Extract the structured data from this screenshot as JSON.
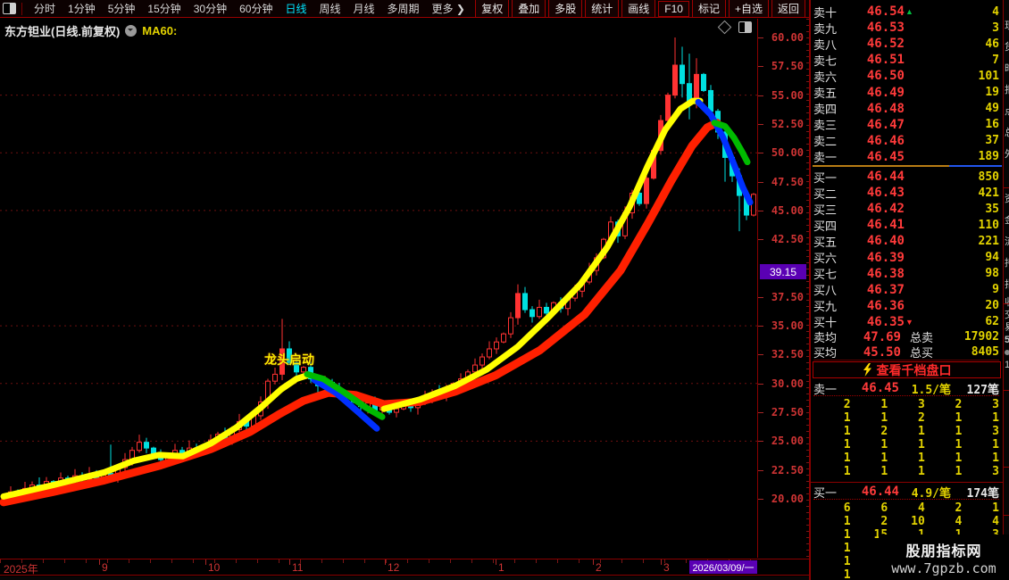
{
  "colors": {
    "up": "#ff3232",
    "down": "#00e0e0",
    "ma_yellow": "#ffff00",
    "ma_red": "#ff2000",
    "ma_green": "#00bb00",
    "ma_blue": "#0030ff",
    "axis_red": "#cf3434",
    "grid_red": "#6e1010",
    "marker_purple": "#5a00b4",
    "active_cyan": "#00e5ff",
    "vol_yellow": "#e3d300",
    "price_red": "#ff3a3a"
  },
  "toolbar": {
    "periods": [
      "分时",
      "1分钟",
      "5分钟",
      "15分钟",
      "30分钟",
      "60分钟",
      "日线",
      "周线",
      "月线",
      "多周期",
      "更多 ❯"
    ],
    "active_index": 6,
    "right_buttons": [
      "复权",
      "叠加",
      "多股",
      "统计",
      "画线",
      "F10",
      "标记",
      "+自选",
      "返回"
    ]
  },
  "chart": {
    "title": "东方钽业(日线.前复权)",
    "indicator_label": "MA60:",
    "annotation": "龙头启动",
    "price_marker": "39.15",
    "period_box": "日线",
    "date_box": "2026/03/09/一",
    "y_ticks": [
      "60.00",
      "57.50",
      "55.00",
      "52.50",
      "50.00",
      "47.50",
      "45.00",
      "42.50",
      "37.50",
      "35.00",
      "32.50",
      "30.00",
      "27.50",
      "25.00",
      "22.50",
      "20.00"
    ],
    "grid_levels": [
      55,
      50,
      45,
      35,
      30,
      25
    ],
    "x_labels": [
      {
        "t": "2025年",
        "x": 4
      },
      {
        "t": "9",
        "x": 114
      },
      {
        "t": "10",
        "x": 233
      },
      {
        "t": "11",
        "x": 327
      },
      {
        "t": "12",
        "x": 434
      },
      {
        "t": "1",
        "x": 558
      },
      {
        "t": "2",
        "x": 667
      },
      {
        "t": "3",
        "x": 743
      }
    ]
  },
  "chart_data": {
    "type": "candlestick",
    "symbol": "东方钽业",
    "period": "日线",
    "adjust": "前复权",
    "ylim": [
      15,
      61.3
    ],
    "open_first": 20.1,
    "closes": [
      20.3,
      20.6,
      20.4,
      20.9,
      21.2,
      21.0,
      21.5,
      21.2,
      21.8,
      21.5,
      22.0,
      21.7,
      22.1,
      21.8,
      22.2,
      22.0,
      22.7,
      23.4,
      24.2,
      24.9,
      24.4,
      23.8,
      23.4,
      23.8,
      24.2,
      23.9,
      24.4,
      24.1,
      24.6,
      25.1,
      25.6,
      25.2,
      26.0,
      26.7,
      26.3,
      27.2,
      28.4,
      30.2,
      30.8,
      33.0,
      31.8,
      31.0,
      31.4,
      30.4,
      29.8,
      30.1,
      29.4,
      28.8,
      29.0,
      28.4,
      28.0,
      28.3,
      27.7,
      27.9,
      27.5,
      27.8,
      28.2,
      27.9,
      28.4,
      28.8,
      29.2,
      28.9,
      29.5,
      30.0,
      30.4,
      31.0,
      31.6,
      32.3,
      33.0,
      33.6,
      34.3,
      35.7,
      37.8,
      36.4,
      35.8,
      36.6,
      36.1,
      37.0,
      36.5,
      37.4,
      38.0,
      38.8,
      39.8,
      40.9,
      42.5,
      44.0,
      42.8,
      44.8,
      46.5,
      45.6,
      47.8,
      50.2,
      52.8,
      55.0,
      57.6,
      56.0,
      54.3,
      56.8,
      55.4,
      53.6,
      51.8,
      49.6,
      48.0,
      46.3,
      44.6,
      46.4
    ],
    "wick_overrides": {
      "15": [
        24.7,
        null
      ],
      "39": [
        35.6,
        null
      ],
      "72": [
        38.6,
        null
      ],
      "94": [
        60.0,
        null
      ],
      "95": [
        59.2,
        54.8
      ],
      "96": [
        58.6,
        52.9
      ],
      "97": [
        58.2,
        null
      ],
      "101": [
        null,
        47.5
      ],
      "103": [
        null,
        43.2
      ]
    },
    "ma_bands": [
      {
        "name": "ma-band-red",
        "color": "#ff2000",
        "w": 9,
        "pts": [
          [
            4,
            19.7
          ],
          [
            60,
            20.6
          ],
          [
            117,
            21.6
          ],
          [
            180,
            22.9
          ],
          [
            236,
            24.3
          ],
          [
            280,
            25.8
          ],
          [
            312,
            27.3
          ],
          [
            340,
            28.5
          ],
          [
            368,
            29.2
          ],
          [
            398,
            29.0
          ],
          [
            430,
            28.2
          ],
          [
            470,
            28.4
          ],
          [
            510,
            29.3
          ],
          [
            555,
            30.7
          ],
          [
            605,
            32.9
          ],
          [
            655,
            36.0
          ],
          [
            695,
            39.8
          ],
          [
            725,
            43.8
          ],
          [
            752,
            47.6
          ],
          [
            775,
            50.6
          ],
          [
            792,
            52.2
          ],
          [
            803,
            52.6
          ]
        ]
      },
      {
        "name": "ma-band-yellow-a",
        "color": "#ffff00",
        "w": 7,
        "pts": [
          [
            4,
            20.2
          ],
          [
            60,
            21.2
          ],
          [
            117,
            22.3
          ],
          [
            150,
            23.3
          ],
          [
            178,
            23.8
          ],
          [
            205,
            23.7
          ],
          [
            236,
            24.8
          ],
          [
            265,
            26.2
          ],
          [
            292,
            27.9
          ],
          [
            315,
            29.5
          ],
          [
            332,
            30.4
          ],
          [
            344,
            30.7
          ]
        ]
      },
      {
        "name": "ma-band-yellow-b",
        "color": "#ffff00",
        "w": 7,
        "pts": [
          [
            430,
            27.8
          ],
          [
            470,
            28.6
          ],
          [
            510,
            29.8
          ],
          [
            545,
            31.2
          ],
          [
            580,
            33.2
          ],
          [
            615,
            35.8
          ],
          [
            650,
            38.6
          ],
          [
            680,
            41.8
          ],
          [
            705,
            45.3
          ],
          [
            725,
            48.8
          ],
          [
            745,
            52.0
          ],
          [
            762,
            53.8
          ],
          [
            776,
            54.5
          ],
          [
            784,
            54.5
          ]
        ]
      },
      {
        "name": "ma-band-blue-nov",
        "color": "#0030ff",
        "w": 7,
        "pts": [
          [
            352,
            30.3
          ],
          [
            376,
            29.2
          ],
          [
            400,
            27.6
          ],
          [
            422,
            26.1
          ]
        ]
      },
      {
        "name": "ma-band-green-nov",
        "color": "#00bb00",
        "w": 7,
        "pts": [
          [
            344,
            30.8
          ],
          [
            362,
            30.4
          ],
          [
            386,
            29.2
          ],
          [
            410,
            27.9
          ],
          [
            428,
            27.1
          ]
        ]
      },
      {
        "name": "ma-band-blue-top",
        "color": "#0030ff",
        "w": 7,
        "pts": [
          [
            782,
            54.4
          ],
          [
            796,
            53.3
          ],
          [
            810,
            51.3
          ],
          [
            822,
            49.0
          ],
          [
            832,
            47.0
          ],
          [
            840,
            45.7
          ]
        ]
      },
      {
        "name": "ma-band-green-top",
        "color": "#00bb00",
        "w": 7,
        "pts": [
          [
            800,
            52.6
          ],
          [
            812,
            52.3
          ],
          [
            822,
            51.3
          ],
          [
            831,
            50.1
          ],
          [
            837,
            49.2
          ]
        ]
      }
    ]
  },
  "order_book": {
    "asks": [
      {
        "l": "卖十",
        "p": "46.54",
        "v": "4",
        "arrow": "up"
      },
      {
        "l": "卖九",
        "p": "46.53",
        "v": "3"
      },
      {
        "l": "卖八",
        "p": "46.52",
        "v": "46"
      },
      {
        "l": "卖七",
        "p": "46.51",
        "v": "7"
      },
      {
        "l": "卖六",
        "p": "46.50",
        "v": "101"
      },
      {
        "l": "卖五",
        "p": "46.49",
        "v": "19"
      },
      {
        "l": "卖四",
        "p": "46.48",
        "v": "49"
      },
      {
        "l": "卖三",
        "p": "46.47",
        "v": "16"
      },
      {
        "l": "卖二",
        "p": "46.46",
        "v": "37"
      },
      {
        "l": "卖一",
        "p": "46.45",
        "v": "189"
      }
    ],
    "bids": [
      {
        "l": "买一",
        "p": "46.44",
        "v": "850"
      },
      {
        "l": "买二",
        "p": "46.43",
        "v": "421"
      },
      {
        "l": "买三",
        "p": "46.42",
        "v": "35"
      },
      {
        "l": "买四",
        "p": "46.41",
        "v": "110"
      },
      {
        "l": "买五",
        "p": "46.40",
        "v": "221"
      },
      {
        "l": "买六",
        "p": "46.39",
        "v": "94"
      },
      {
        "l": "买七",
        "p": "46.38",
        "v": "98"
      },
      {
        "l": "买八",
        "p": "46.37",
        "v": "9"
      },
      {
        "l": "买九",
        "p": "46.36",
        "v": "20"
      },
      {
        "l": "买十",
        "p": "46.35",
        "v": "62",
        "arrow": "down"
      }
    ],
    "vs_ratio": 0.72,
    "sell_avg_label": "卖均",
    "sell_avg": "47.69",
    "total_sell_label": "总卖",
    "total_sell": "17902",
    "buy_avg_label": "买均",
    "buy_avg": "45.50",
    "total_buy_label": "总买",
    "total_buy": "8405",
    "thousand_button": "查看千档盘口",
    "sell_one": {
      "label": "卖一",
      "price": "46.45",
      "per": "1.5/笔",
      "count": "127笔"
    },
    "sell_queue": [
      [
        "2",
        "1",
        "3",
        "2",
        "3"
      ],
      [
        "1",
        "1",
        "2",
        "1",
        "1"
      ],
      [
        "1",
        "2",
        "1",
        "1",
        "3"
      ],
      [
        "1",
        "1",
        "1",
        "1",
        "1"
      ],
      [
        "1",
        "1",
        "1",
        "1",
        "1"
      ],
      [
        "1",
        "1",
        "1",
        "1",
        "3"
      ]
    ],
    "buy_one": {
      "label": "买一",
      "price": "46.44",
      "per": "4.9/笔",
      "count": "174笔"
    },
    "buy_queue": [
      [
        "6",
        "6",
        "4",
        "2",
        "1"
      ],
      [
        "1",
        "2",
        "10",
        "4",
        "4"
      ],
      [
        "1",
        "15",
        "1",
        "1",
        "3"
      ],
      [
        "1",
        "",
        "",
        "",
        ""
      ],
      [
        "1",
        "",
        "",
        "",
        ""
      ],
      [
        "1",
        "",
        "",
        "",
        ""
      ]
    ]
  },
  "side_strip": {
    "chars": [
      "现",
      "货",
      "时",
      "报",
      "点",
      "总",
      "外",
      "资",
      "金",
      "流",
      "持",
      "指",
      "收",
      "交",
      "易"
    ],
    "extra_top": "5",
    "extra_bottom": "1"
  },
  "watermark": {
    "line1": "股朋指标网",
    "line2": "www.7gpzb.com"
  }
}
